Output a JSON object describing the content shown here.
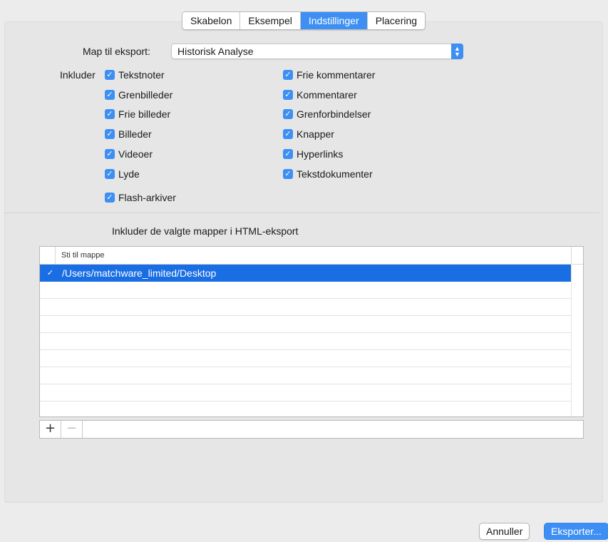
{
  "tabs": [
    "Skabelon",
    "Eksempel",
    "Indstillinger",
    "Placering"
  ],
  "active_tab": "Indstillinger",
  "map": {
    "label": "Map til eksport:",
    "selected": "Historisk Analyse"
  },
  "include": {
    "label": "Inkluder",
    "left": [
      "Tekstnoter",
      "Grenbilleder",
      "Frie billeder",
      "Billeder",
      "Videoer",
      "Lyde",
      "Flash-arkiver"
    ],
    "right": [
      "Frie kommentarer",
      "Kommentarer",
      "Grenforbindelser",
      "Knapper",
      "Hyperlinks",
      "Tekstdokumenter"
    ],
    "checked": true
  },
  "folders": {
    "heading": "Inkluder de valgte mapper i HTML-eksport",
    "column_header": "Sti til mappe",
    "rows": [
      {
        "checked": true,
        "path": "/Users/matchware_limited/Desktop",
        "selected": true
      }
    ],
    "add_label": "+",
    "remove_label": "−"
  },
  "buttons": {
    "cancel": "Annuller",
    "export": "Eksporter..."
  },
  "colors": {
    "accent": "#3d8ff4",
    "selection": "#1a6ee3"
  }
}
